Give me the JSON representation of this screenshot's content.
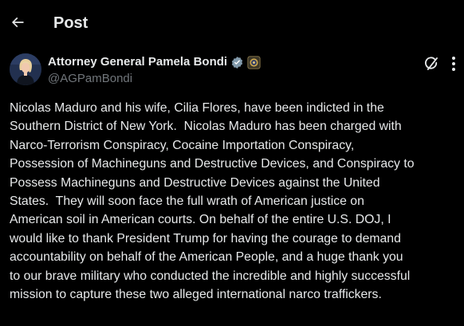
{
  "header": {
    "title": "Post",
    "back_icon": "arrow-left-icon"
  },
  "post": {
    "author": {
      "display_name": "Attorney General Pamela Bondi",
      "handle": "@AGPamBondi",
      "verified_icon": "verified-badge-icon",
      "affiliation_icon": "government-seal-icon"
    },
    "actions": {
      "grok_icon": "grok-icon",
      "more_icon": "more-dots-vertical-icon"
    },
    "text": "Nicolas Maduro and his wife, Cilia Flores, have been indicted in the\nSouthern District of New York.  Nicolas Maduro has been charged with\nNarco-Terrorism Conspiracy, Cocaine Importation Conspiracy,\nPossession of Machineguns and Destructive Devices, and Conspiracy to\nPossess Machineguns and Destructive Devices against the United\nStates.  They will soon face the full wrath of American justice on\nAmerican soil in American courts. On behalf of the entire U.S. DOJ, I\nwould like to thank President Trump for having the courage to demand\naccountability on behalf of the American People, and a huge thank you\nto our brave military who conducted the incredible and highly successful\nmission to capture these two alleged international narco traffickers."
  },
  "colors": {
    "background": "#000000",
    "primary_text": "#e7e9ea",
    "secondary_text": "#71767b",
    "verified_badge": "#829aab"
  }
}
